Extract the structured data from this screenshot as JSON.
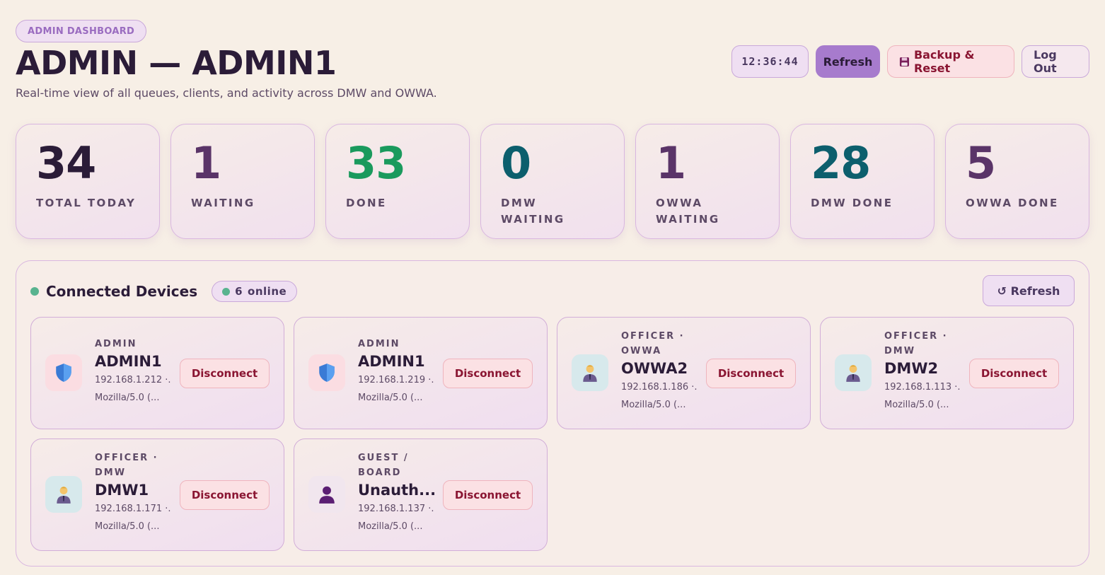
{
  "header": {
    "badge": "ADMIN DASHBOARD",
    "title": "ADMIN — ADMIN1",
    "subtitle": "Real-time view of all queues, clients, and activity across DMW and OWWA.",
    "clock": "12:36:44",
    "refresh_label": "Refresh",
    "backup_label": "Backup & Reset",
    "backup_icon": "floppy-disk-icon",
    "logout_label": "Log Out"
  },
  "stats": [
    {
      "value": "34",
      "label": "TOTAL TODAY",
      "color": "#2b1c38"
    },
    {
      "value": "1",
      "label": "WAITING",
      "color": "#5a3468"
    },
    {
      "value": "33",
      "label": "DONE",
      "color": "#1a9a5d"
    },
    {
      "value": "0",
      "label": "DMW WAITING",
      "color": "#0c5f6d"
    },
    {
      "value": "1",
      "label": "OWWA WAITING",
      "color": "#5a3468"
    },
    {
      "value": "28",
      "label": "DMW DONE",
      "color": "#0c5f6d"
    },
    {
      "value": "5",
      "label": "OWWA DONE",
      "color": "#5a3468"
    }
  ],
  "devices_panel": {
    "title": "Connected Devices",
    "online_count": "6",
    "online_label": "online",
    "refresh_label": "↺ Refresh",
    "status_color": "#58b38f",
    "devices": [
      {
        "role": "ADMIN",
        "name": "ADMIN1",
        "ip": "192.168.1.212 ·...",
        "ua": "Mozilla/5.0 (...",
        "icon": "shield-icon",
        "kind": "admin",
        "action": "Disconnect"
      },
      {
        "role": "ADMIN",
        "name": "ADMIN1",
        "ip": "192.168.1.219 ·...",
        "ua": "Mozilla/5.0 (...",
        "icon": "shield-icon",
        "kind": "admin",
        "action": "Disconnect"
      },
      {
        "role": "OFFICER · OWWA",
        "name": "OWWA2",
        "ip": "192.168.1.186 ·...",
        "ua": "Mozilla/5.0 (...",
        "icon": "officer-icon",
        "kind": "officer",
        "action": "Disconnect"
      },
      {
        "role": "OFFICER · DMW",
        "name": "DMW2",
        "ip": "192.168.1.113 ·...",
        "ua": "Mozilla/5.0 (...",
        "icon": "officer-icon",
        "kind": "officer",
        "action": "Disconnect"
      },
      {
        "role": "OFFICER · DMW",
        "name": "DMW1",
        "ip": "192.168.1.171 ·...",
        "ua": "Mozilla/5.0 (...",
        "icon": "officer-icon",
        "kind": "officer",
        "action": "Disconnect"
      },
      {
        "role": "GUEST / BOARD",
        "name": "Unauth...",
        "ip": "192.168.1.137 ·...",
        "ua": "Mozilla/5.0 (...",
        "icon": "guest-icon",
        "kind": "guest",
        "action": "Disconnect"
      }
    ]
  }
}
